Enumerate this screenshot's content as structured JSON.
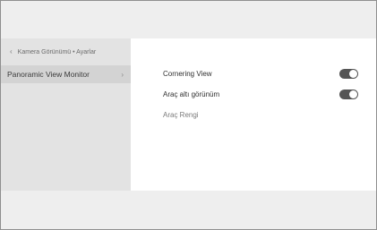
{
  "sidebar": {
    "breadcrumb": {
      "back_icon": "chevron-left-icon",
      "path": "Kamera Görünümü • Ayarlar"
    },
    "items": [
      {
        "label": "Panoramic View Monitor",
        "icon": "chevron-right-icon",
        "selected": true
      }
    ]
  },
  "settings": [
    {
      "label": "Cornering View",
      "toggle": true,
      "enabled": true
    },
    {
      "label": "Araç altı görünüm",
      "toggle": true,
      "enabled": true
    },
    {
      "label": "Araç Rengi",
      "toggle": false
    }
  ],
  "colors": {
    "background": "#f3f3f3",
    "sidebar": "#e3e3e3",
    "selected_item": "#d3d3d3",
    "content": "#ffffff",
    "toggle_on": "#555555"
  }
}
